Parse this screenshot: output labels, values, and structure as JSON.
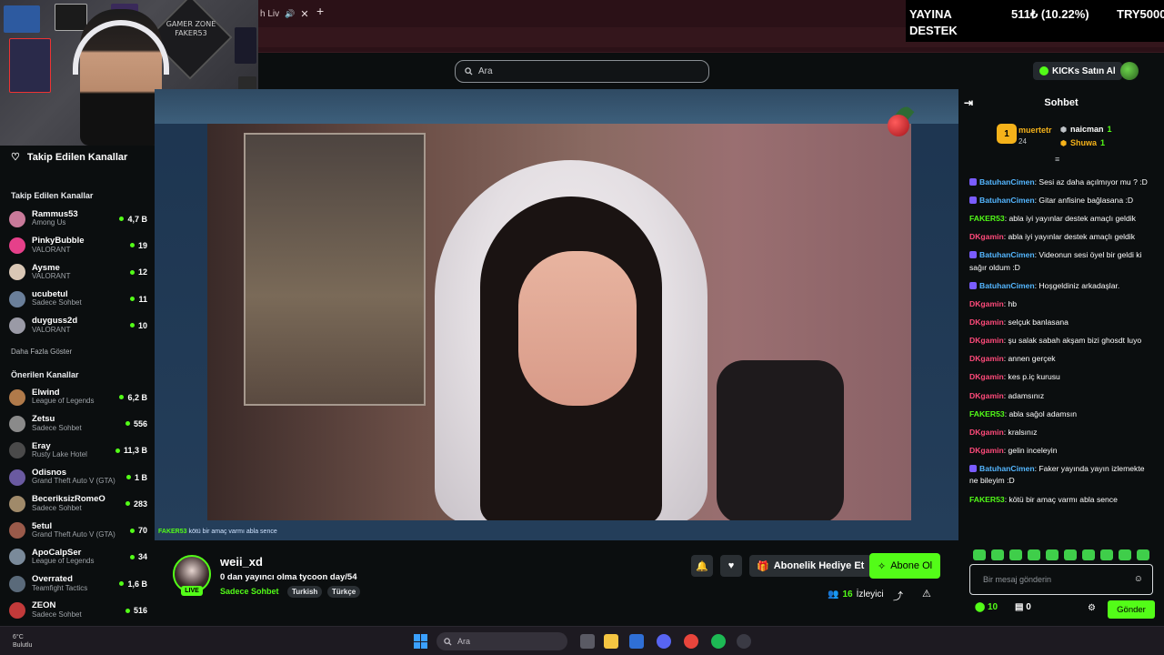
{
  "browser": {
    "tab_title": "h Liv",
    "tab_close": "✕",
    "new_tab": "+"
  },
  "overlay": {
    "line1": "YAYINA",
    "line2": "DESTEK",
    "amount": "511₺ (10.22%)",
    "goal": "TRY5000"
  },
  "webcam": {
    "poster_text": "GAMER ZONE FAKER53"
  },
  "header": {
    "search_placeholder": "Ara",
    "kicks_button": "KICKs Satın Al"
  },
  "sidebar": {
    "title": "Takip Edilen Kanallar",
    "followed_heading": "Takip Edilen Kanallar",
    "followed": [
      {
        "name": "Rammus53",
        "category": "Among Us",
        "viewers": "4,7 B",
        "color": "#c97a9a"
      },
      {
        "name": "PinkyBubble",
        "category": "VALORANT",
        "viewers": "19",
        "color": "#e6408a"
      },
      {
        "name": "Aysme",
        "category": "VALORANT",
        "viewers": "12",
        "color": "#d9c7b5"
      },
      {
        "name": "ucubetul",
        "category": "Sadece Sohbet",
        "viewers": "11",
        "color": "#6a7f9a"
      },
      {
        "name": "duyguss2d",
        "category": "VALORANT",
        "viewers": "10",
        "color": "#9a9aa6"
      }
    ],
    "show_more": "Daha Fazla Göster",
    "recommended_heading": "Önerilen Kanallar",
    "recommended": [
      {
        "name": "Elwind",
        "category": "League of Legends",
        "viewers": "6,2 B",
        "color": "#b07a4a"
      },
      {
        "name": "Zetsu",
        "category": "Sadece Sohbet",
        "viewers": "556",
        "color": "#8a8a8a"
      },
      {
        "name": "Eray",
        "category": "Rusty Lake Hotel",
        "viewers": "11,3 B",
        "color": "#4a4a4a"
      },
      {
        "name": "Odisnos",
        "category": "Grand Theft Auto V (GTA)",
        "viewers": "1 B",
        "color": "#6a5aa0"
      },
      {
        "name": "BeceriksizRomeO",
        "category": "Sadece Sohbet",
        "viewers": "283",
        "color": "#a08a6a"
      },
      {
        "name": "5etul",
        "category": "Grand Theft Auto V (GTA)",
        "viewers": "70",
        "color": "#9a5a4a"
      },
      {
        "name": "ApoCalpSer",
        "category": "League of Legends",
        "viewers": "34",
        "color": "#7a8a9a"
      },
      {
        "name": "Overrated",
        "category": "Teamfight Tactics",
        "viewers": "1,6 B",
        "color": "#5a6a7a"
      },
      {
        "name": "ZEON",
        "category": "Sadece Sohbet",
        "viewers": "516",
        "color": "#c23a3a"
      }
    ]
  },
  "video": {
    "caption_user": "FAKER53",
    "caption_text": " kötü bir amaç varmı abla sence"
  },
  "stream": {
    "channel": "weii_xd",
    "live": "LIVE",
    "title": "0 dan yayıncı olma tycoon day/54",
    "category": "Sadece Sohbet",
    "tags": [
      "Turkish",
      "Türkçe"
    ],
    "gift_button": "Abonelik Hediye Et",
    "subscribe_button": "Abone Ol",
    "viewer_count": "16",
    "viewer_label": "İzleyici"
  },
  "chat": {
    "title": "Sohbet",
    "top_gifter": {
      "rank": "1",
      "name": "muertetr",
      "count": "24"
    },
    "gifters": [
      {
        "name": "naicman",
        "count": "1",
        "color": "#ffffff"
      },
      {
        "name": "Shuwa",
        "count": "1",
        "color": "#f5b21a"
      }
    ],
    "messages": [
      {
        "user": "BatuhanCimen",
        "cls": "u-bat",
        "badge": true,
        "text": "Sesi az daha açılmıyor mu ? :D"
      },
      {
        "user": "BatuhanCimen",
        "cls": "u-bat",
        "badge": true,
        "text": "Gitar anfisine bağlasana :D"
      },
      {
        "user": "FAKER53",
        "cls": "u-fak",
        "badge": false,
        "text": "abla iyi yayınlar destek amaçlı geldik"
      },
      {
        "user": "DKgamin",
        "cls": "u-dk",
        "badge": false,
        "text": "abla iyi yayınlar destek amaçlı geldik"
      },
      {
        "user": "BatuhanCimen",
        "cls": "u-bat",
        "badge": true,
        "text": "Videonun sesi öyel bir geldi ki sağır oldum :D"
      },
      {
        "user": "BatuhanCimen",
        "cls": "u-bat",
        "badge": true,
        "text": "Hoşgeldiniz arkadaşlar."
      },
      {
        "user": "DKgamin",
        "cls": "u-dk",
        "badge": false,
        "text": "hb"
      },
      {
        "user": "DKgamin",
        "cls": "u-dk",
        "badge": false,
        "text": "selçuk banlasana"
      },
      {
        "user": "DKgamin",
        "cls": "u-dk",
        "badge": false,
        "text": "şu salak sabah akşam bizi ghosdt luyo"
      },
      {
        "user": "DKgamin",
        "cls": "u-dk",
        "badge": false,
        "text": "annen gerçek"
      },
      {
        "user": "DKgamin",
        "cls": "u-dk",
        "badge": false,
        "text": "kes p.iç kurusu"
      },
      {
        "user": "DKgamin",
        "cls": "u-dk",
        "badge": false,
        "text": "adamsınız"
      },
      {
        "user": "FAKER53",
        "cls": "u-fak",
        "badge": false,
        "text": "abla sağol adamsın"
      },
      {
        "user": "DKgamin",
        "cls": "u-dk",
        "badge": false,
        "text": "kralsınız"
      },
      {
        "user": "DKgamin",
        "cls": "u-dk",
        "badge": false,
        "text": "gelin inceleyin"
      },
      {
        "user": "BatuhanCimen",
        "cls": "u-bat",
        "badge": true,
        "text": "Faker yayında yayın izlemekte ne bileyim :D"
      },
      {
        "user": "FAKER53",
        "cls": "u-fak",
        "badge": false,
        "text": "kötü bir amaç varmı abla sence"
      }
    ],
    "input_placeholder": "Bir mesaj gönderin",
    "points": "10",
    "points2": "0",
    "send_button": "Gönder"
  },
  "taskbar": {
    "search_placeholder": "Ara",
    "weather": "6°C",
    "weather_desc": "Bulutlu"
  }
}
